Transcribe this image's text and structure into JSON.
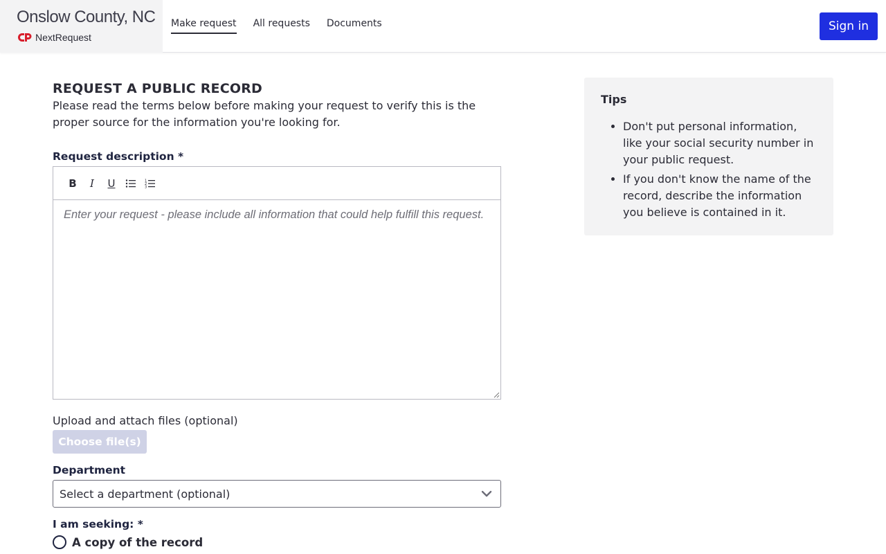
{
  "header": {
    "org_name": "Onslow County, NC",
    "product_name": "NextRequest",
    "logo_icon": "nextrequest-logo-icon",
    "nav": [
      {
        "label": "Make request",
        "active": true
      },
      {
        "label": "All requests",
        "active": false
      },
      {
        "label": "Documents",
        "active": false
      }
    ],
    "signin_label": "Sign in",
    "accent_color": "#1f2fe0",
    "logo_color": "#d81e2c"
  },
  "main": {
    "title": "REQUEST A PUBLIC RECORD",
    "intro": "Please read the terms below before making your request to verify this is the proper source for the information you're looking for.",
    "description_label": "Request description *",
    "toolbar": {
      "bold": "B",
      "italic": "I",
      "underline": "U",
      "bullet_list_icon": "bullet-list-icon",
      "numbered_list_icon": "numbered-list-icon"
    },
    "description_placeholder": "Enter your request - please include all information that could help fulfill this request.",
    "description_value": "",
    "upload_label": "Upload and attach files (optional)",
    "choose_files_label": "Choose file(s)",
    "department_label": "Department",
    "department_selected": "Select a department (optional)",
    "seeking_label": "I am seeking: *",
    "seeking_options": [
      {
        "label": "A copy of the record",
        "selected": false
      }
    ]
  },
  "tips": {
    "title": "Tips",
    "items": [
      "Don't put personal information, like your social security number in your public request.",
      "If you don't know the name of the record, describe the information you believe is contained in it."
    ]
  }
}
